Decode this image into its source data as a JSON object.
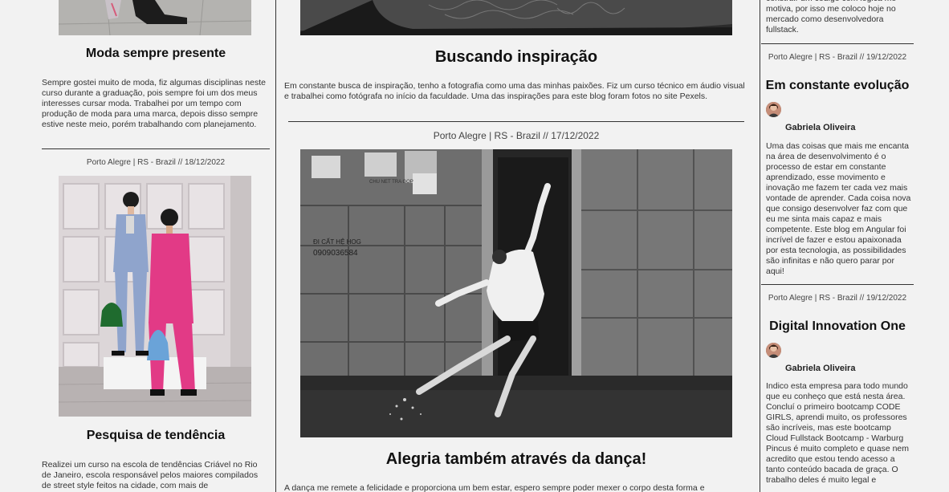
{
  "left": {
    "post1": {
      "title": "Moda sempre presente",
      "text": "Sempre gostei muito de moda, fiz algumas disciplinas neste curso durante a graduação, pois sempre foi um dos meus interesses cursar moda. Trabalhei por um tempo com produção de moda para uma marca, depois disso sempre estive neste meio, porém trabalhando com planejamento."
    },
    "post2": {
      "meta": "Porto Alegre | RS - Brazil // 18/12/2022",
      "title": "Pesquisa de tendência",
      "text": "Realizei um curso na escola de tendências Criável no Rio de Janeiro, escola responsável pelos maiores compilados de street style feitos na cidade, com mais de"
    }
  },
  "main": {
    "post1": {
      "title": "Buscando inspiração",
      "text": "Em constante busca de inspiração, tenho a fotografia como uma das minhas paixões. Fiz um curso técnico em áudio visual e trabalhei como fotógrafa no início da faculdade. Uma das inspirações para este blog foram fotos no site Pexels."
    },
    "post2": {
      "meta": "Porto Alegre | RS - Brazil // 17/12/2022",
      "poster_text": "CHU NET TRA GOP",
      "wall_text_1": "ĐI CẤT HỆ HOG",
      "wall_text_2": "0909036584",
      "title": "Alegria também através da dança!",
      "text": "A dança me remete a felicidade e proporciona um bem estar, espero sempre poder mexer o corpo desta forma e"
    }
  },
  "right": {
    "top_text": "construir um código com lógica me motiva, por isso me coloco hoje no mercado como desenvolvedora fullstack.",
    "post1": {
      "meta": "Porto Alegre | RS - Brazil // 19/12/2022",
      "title": "Em constante evolução",
      "author": "Gabriela Oliveira",
      "text": "Uma das coisas que mais me encanta na área de desenvolvimento é o processo de estar em constante aprendizado, esse movimento e inovação me fazem ter cada vez mais vontade de aprender. Cada coisa nova que consigo desenvolver faz com que eu me sinta mais capaz e mais competente. Este blog em Angular foi incrível de fazer e estou apaixonada por esta tecnologia, as possibilidades são infinitas e não quero parar por aqui!"
    },
    "post2": {
      "meta": "Porto Alegre | RS - Brazil // 19/12/2022",
      "title": "Digital Innovation One",
      "author": "Gabriela Oliveira",
      "text": "Indico esta empresa para todo mundo que eu conheço que está nesta área. Concluí o primeiro bootcamp CODE GIRLS, aprendi muito, os professores são incríveis, mas este bootcamp Cloud Fullstack Bootcamp - Warburg Pincus é muito completo e quase nem acredito que estou tendo acesso a tanto conteúdo bacada de graça. O trabalho deles é muito legal e"
    }
  },
  "colors": {
    "background": "#f2f2f2",
    "divider": "#333333",
    "text": "#222222"
  }
}
